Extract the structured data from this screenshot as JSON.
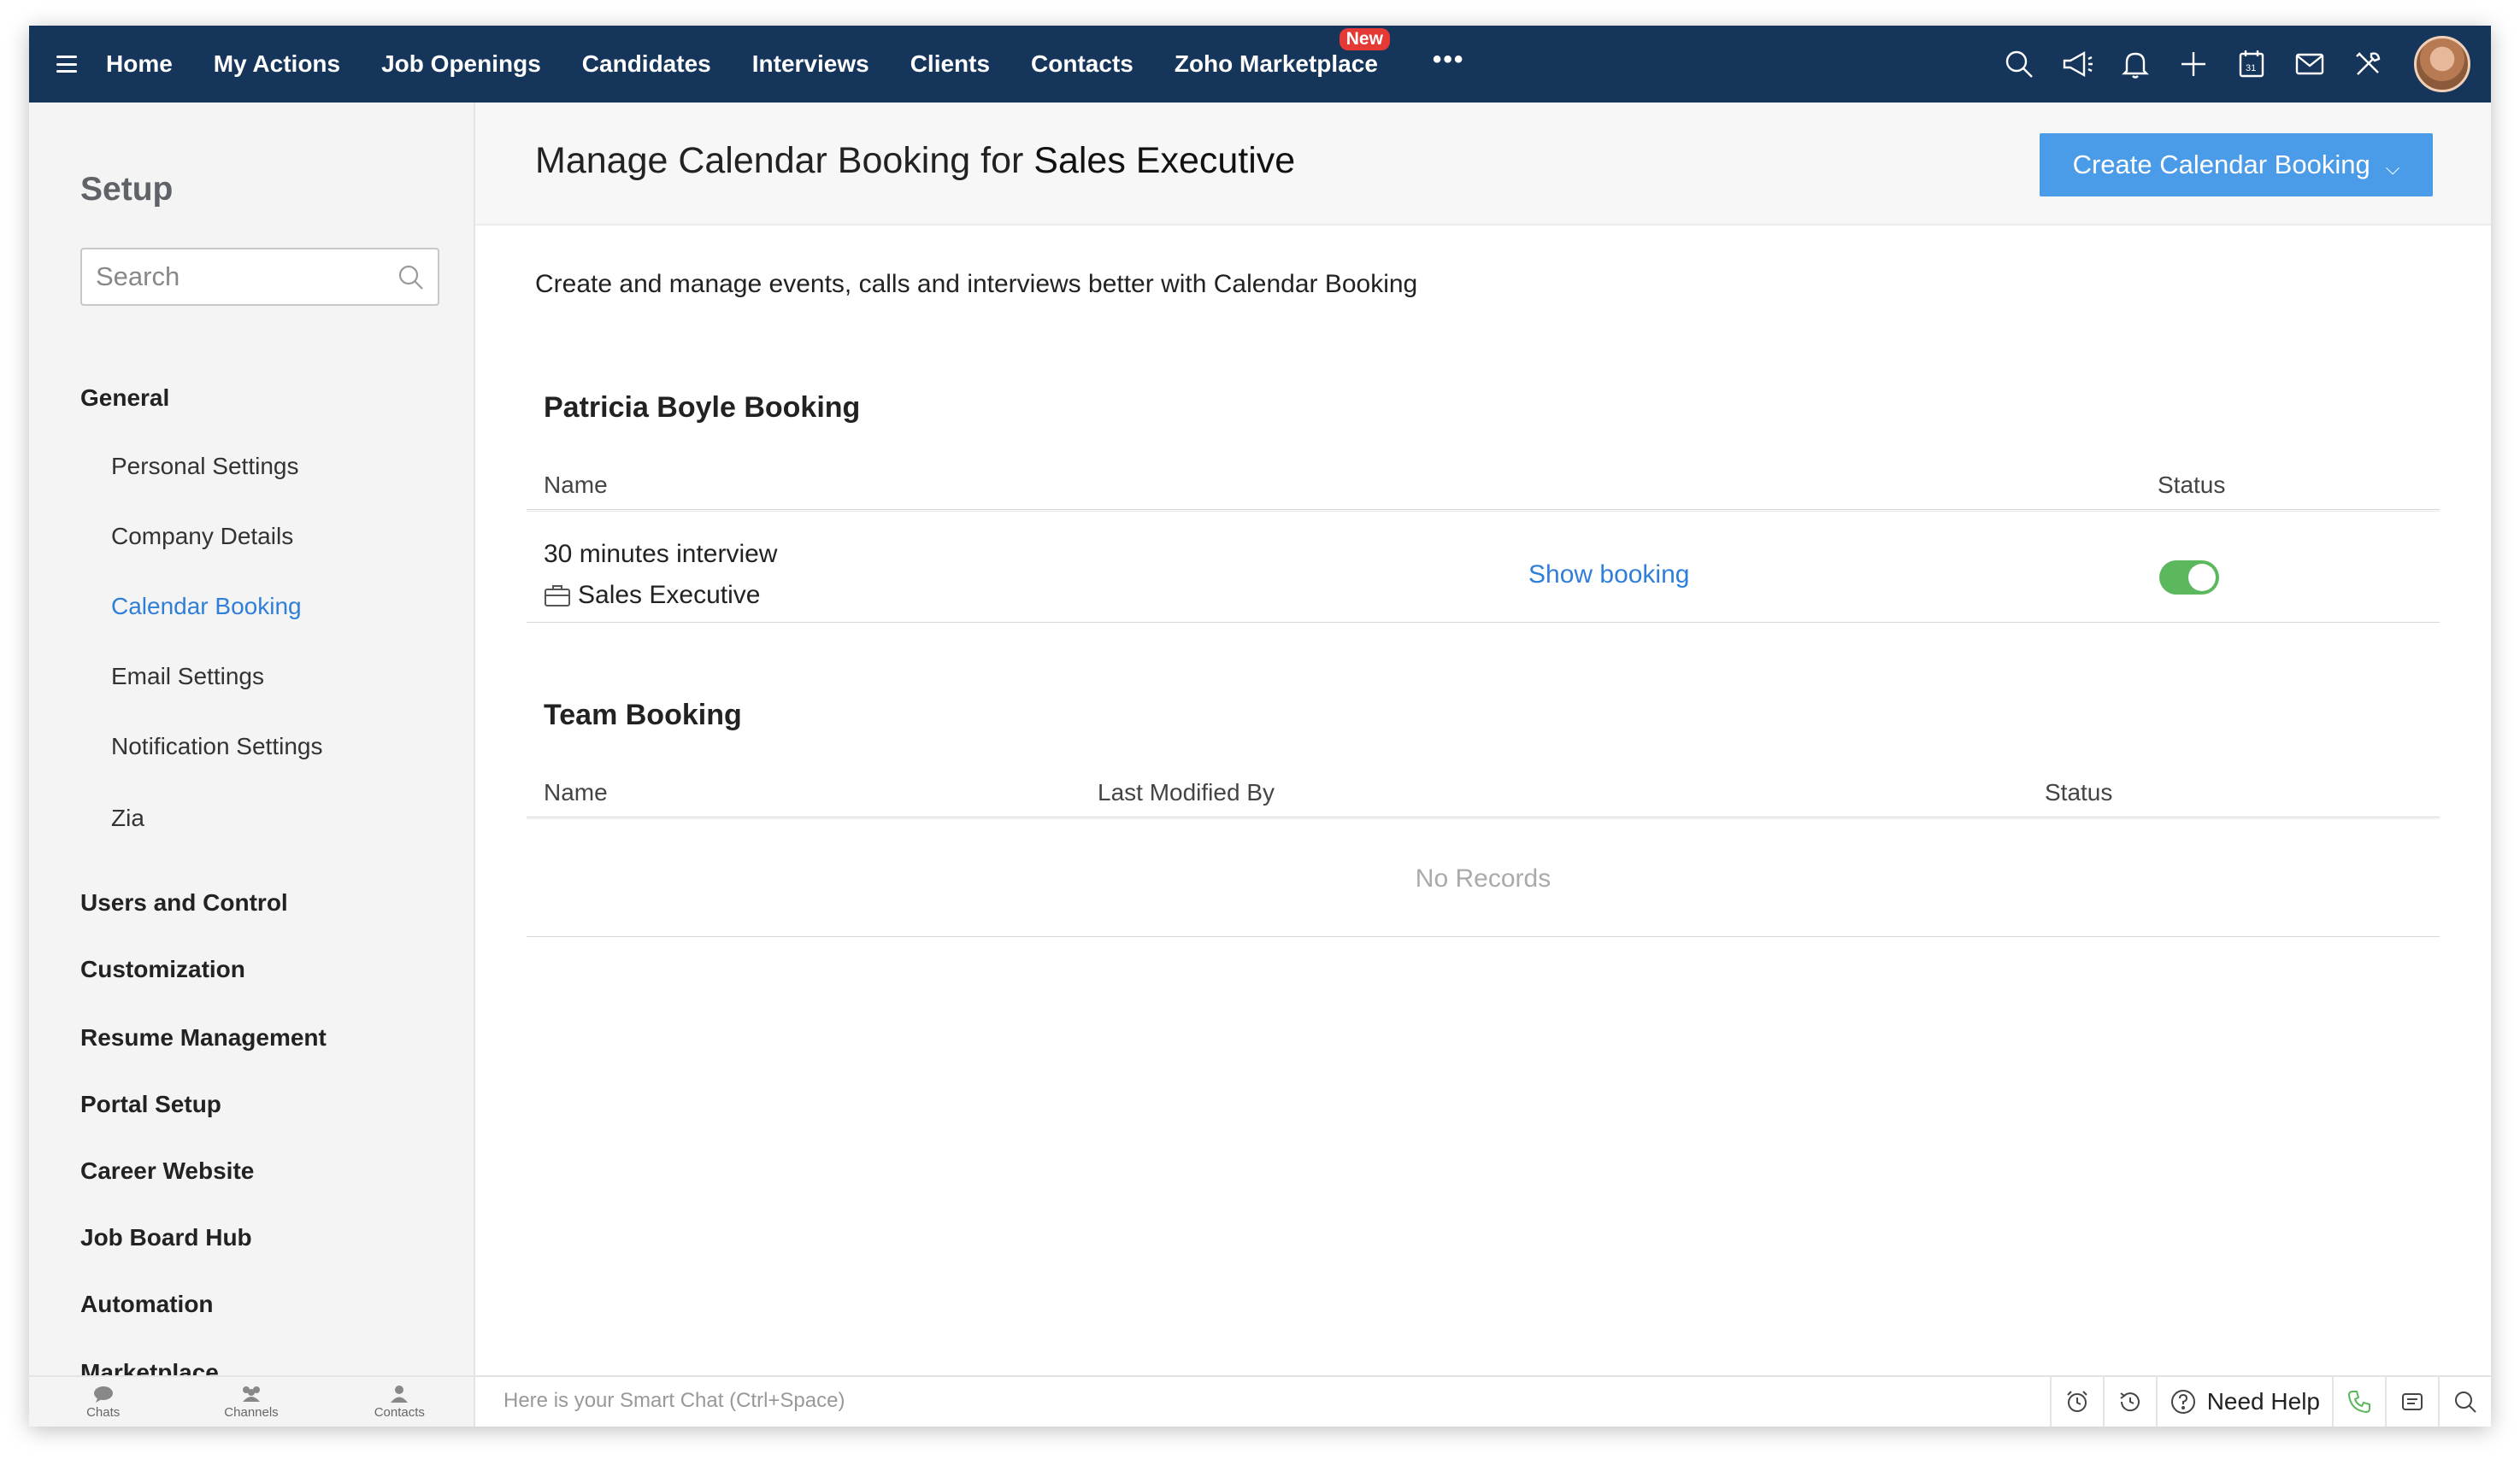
{
  "topnav": {
    "items": [
      "Home",
      "My Actions",
      "Job Openings",
      "Candidates",
      "Interviews",
      "Clients",
      "Contacts",
      "Zoho Marketplace"
    ],
    "new_badge": "New",
    "more": "•••"
  },
  "sidebar": {
    "title": "Setup",
    "search_placeholder": "Search",
    "general": "General",
    "general_items": [
      "Personal Settings",
      "Company Details",
      "Calendar Booking",
      "Email Settings",
      "Notification Settings",
      "Zia"
    ],
    "active_item": "Calendar Booking",
    "groups": [
      "Users and Control",
      "Customization",
      "Resume Management",
      "Portal Setup",
      "Career Website",
      "Job Board Hub",
      "Automation",
      "Marketplace"
    ]
  },
  "main": {
    "title_prefix": "Manage Calendar Booking for",
    "title_role": "Sales Executive",
    "create_button": "Create Calendar Booking",
    "intro": "Create and manage events, calls and interviews better with Calendar Booking",
    "personal": {
      "title": "Patricia Boyle Booking",
      "col_name": "Name",
      "col_status": "Status",
      "row": {
        "name": "30 minutes interview",
        "job": "Sales Executive",
        "action": "Show booking",
        "status_on": true
      }
    },
    "team": {
      "title": "Team Booking",
      "col_name": "Name",
      "col_modified": "Last Modified By",
      "col_status": "Status",
      "empty": "No Records"
    }
  },
  "bottombar": {
    "tabs": [
      "Chats",
      "Channels",
      "Contacts"
    ],
    "smart_chat": "Here is your Smart Chat (Ctrl+Space)",
    "need_help": "Need Help"
  },
  "colors": {
    "nav_bg": "#16355b",
    "accent": "#2f7ed8",
    "button": "#4a9be8",
    "toggle_on": "#5cb85c",
    "badge": "#e53935"
  }
}
